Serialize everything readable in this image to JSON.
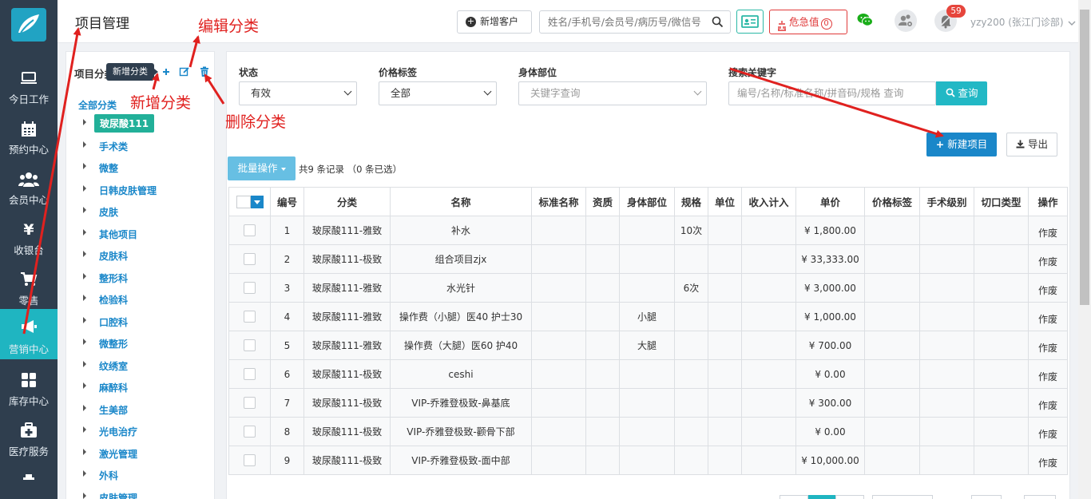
{
  "app": {
    "page_title": "项目管理"
  },
  "nav": {
    "items": [
      {
        "label": "今日工作",
        "icon": "monitor-icon"
      },
      {
        "label": "预约中心",
        "icon": "calendar-icon"
      },
      {
        "label": "会员中心",
        "icon": "users-icon"
      },
      {
        "label": "收银台",
        "icon": "yuan-icon"
      },
      {
        "label": "零售",
        "icon": "cart-icon"
      },
      {
        "label": "营销中心",
        "icon": "megaphone-icon",
        "active": true
      },
      {
        "label": "库存中心",
        "icon": "grid-icon"
      },
      {
        "label": "医疗服务",
        "icon": "medical-kit-icon"
      }
    ]
  },
  "topbar": {
    "add_customer": "新增客户",
    "search_placeholder": "姓名/手机号/会员号/病历号/微信号",
    "urgent_label": "危急值",
    "urgent_count": "0",
    "notify_count": "59",
    "user": "yzy200 (张江门诊部)"
  },
  "categories": {
    "header": "项目分类",
    "tooltip": "新增分类",
    "all_label": "全部分类",
    "items": [
      {
        "label": "玻尿酸111",
        "selected": true
      },
      {
        "label": "手术类"
      },
      {
        "label": "微整"
      },
      {
        "label": "日韩皮肤管理"
      },
      {
        "label": "皮肤"
      },
      {
        "label": "其他项目"
      },
      {
        "label": "皮肤科"
      },
      {
        "label": "整形科"
      },
      {
        "label": "检验科"
      },
      {
        "label": "口腔科"
      },
      {
        "label": "微整形"
      },
      {
        "label": "纹绣室"
      },
      {
        "label": "麻醉科"
      },
      {
        "label": "生美部"
      },
      {
        "label": "光电治疗"
      },
      {
        "label": "激光管理"
      },
      {
        "label": "外科"
      },
      {
        "label": "皮肤管理"
      }
    ]
  },
  "annotations": {
    "edit": "编辑分类",
    "add": "新增分类",
    "delete": "删除分类"
  },
  "filters": {
    "status_label": "状态",
    "status_value": "有效",
    "price_tag_label": "价格标签",
    "price_tag_value": "全部",
    "body_part_label": "身体部位",
    "body_part_placeholder": "关键字查询",
    "keyword_label": "搜索关键字",
    "keyword_placeholder": "编号/名称/标准名称/拼音码/规格 查询",
    "query_button": "查询"
  },
  "actions": {
    "new_item": "新建项目",
    "export": "导出",
    "batch": "批量操作",
    "record_info": "共9 条记录 （0 条已选）"
  },
  "table": {
    "columns": [
      "编号",
      "分类",
      "名称",
      "标准名称",
      "资质",
      "身体部位",
      "规格",
      "单位",
      "收入计入",
      "单价",
      "价格标签",
      "手术级别",
      "切口类型",
      "操作"
    ],
    "rows": [
      {
        "no": "1",
        "category": "玻尿酸111-雅致",
        "name": "补水",
        "std_name": "",
        "qual": "",
        "body": "",
        "spec": "10次",
        "unit": "",
        "income": "",
        "price": "¥ 1,800.00",
        "tag": "",
        "level": "",
        "cut": "",
        "op": "作废"
      },
      {
        "no": "2",
        "category": "玻尿酸111-极致",
        "name": "组合项目zjx",
        "std_name": "",
        "qual": "",
        "body": "",
        "spec": "",
        "unit": "",
        "income": "",
        "price": "¥ 33,333.00",
        "tag": "",
        "level": "",
        "cut": "",
        "op": "作废"
      },
      {
        "no": "3",
        "category": "玻尿酸111-雅致",
        "name": "水光针",
        "std_name": "",
        "qual": "",
        "body": "",
        "spec": "6次",
        "unit": "",
        "income": "",
        "price": "¥ 3,000.00",
        "tag": "",
        "level": "",
        "cut": "",
        "op": "作废"
      },
      {
        "no": "4",
        "category": "玻尿酸111-雅致",
        "name": "操作费（小腿）医40 护士30",
        "std_name": "",
        "qual": "",
        "body": "小腿",
        "spec": "",
        "unit": "",
        "income": "",
        "price": "¥ 1,000.00",
        "tag": "",
        "level": "",
        "cut": "",
        "op": "作废"
      },
      {
        "no": "5",
        "category": "玻尿酸111-雅致",
        "name": "操作费（大腿）医60 护40",
        "std_name": "",
        "qual": "",
        "body": "大腿",
        "spec": "",
        "unit": "",
        "income": "",
        "price": "¥ 700.00",
        "tag": "",
        "level": "",
        "cut": "",
        "op": "作废"
      },
      {
        "no": "6",
        "category": "玻尿酸111-极致",
        "name": "ceshi",
        "std_name": "",
        "qual": "",
        "body": "",
        "spec": "",
        "unit": "",
        "income": "",
        "price": "¥ 0.00",
        "tag": "",
        "level": "",
        "cut": "",
        "op": "作废"
      },
      {
        "no": "7",
        "category": "玻尿酸111-极致",
        "name": "VIP-乔雅登极致-鼻基底",
        "std_name": "",
        "qual": "",
        "body": "",
        "spec": "",
        "unit": "",
        "income": "",
        "price": "¥ 300.00",
        "tag": "",
        "level": "",
        "cut": "",
        "op": "作废"
      },
      {
        "no": "8",
        "category": "玻尿酸111-极致",
        "name": "VIP-乔雅登极致-颧骨下部",
        "std_name": "",
        "qual": "",
        "body": "",
        "spec": "",
        "unit": "",
        "income": "",
        "price": "¥ 0.00",
        "tag": "",
        "level": "",
        "cut": "",
        "op": "作废"
      },
      {
        "no": "9",
        "category": "玻尿酸111-极致",
        "name": "VIP-乔雅登极致-面中部",
        "std_name": "",
        "qual": "",
        "body": "",
        "spec": "",
        "unit": "",
        "income": "",
        "price": "¥ 10,000.00",
        "tag": "",
        "level": "",
        "cut": "",
        "op": "作废"
      }
    ]
  },
  "colors": {
    "nav_bg": "#2f3e4e",
    "nav_active": "#1fb5c1",
    "primary": "#1a87c9",
    "teal": "#22b8c5",
    "annotation": "#e0211f"
  }
}
